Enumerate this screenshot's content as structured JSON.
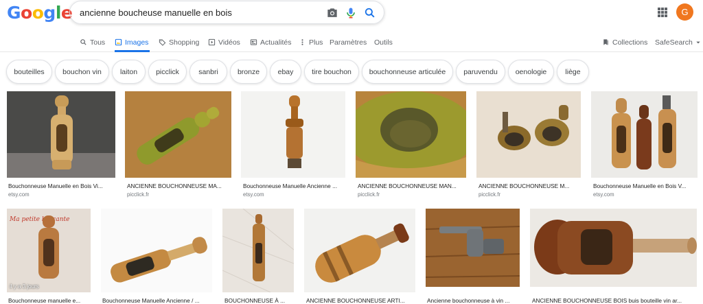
{
  "search": {
    "query": "ancienne boucheuse manuelle en bois"
  },
  "header": {
    "avatar_letter": "G",
    "avatar_color": "#f0771f"
  },
  "tabs": [
    {
      "label": "Tous",
      "icon": "search-icon"
    },
    {
      "label": "Images",
      "icon": "image-icon"
    },
    {
      "label": "Shopping",
      "icon": "tag-icon"
    },
    {
      "label": "Vidéos",
      "icon": "play-icon"
    },
    {
      "label": "Actualités",
      "icon": "news-icon"
    },
    {
      "label": "Plus",
      "icon": "more-vert-icon"
    },
    {
      "label": "Paramètres"
    },
    {
      "label": "Outils"
    }
  ],
  "right_tools": {
    "collections": "Collections",
    "safesearch": "SafeSearch"
  },
  "chips": [
    "bouteilles",
    "bouchon vin",
    "laiton",
    "picclick",
    "sanbri",
    "bronze",
    "ebay",
    "tire bouchon",
    "bouchonneuse articulée",
    "paruvendu",
    "oenologie",
    "liège"
  ],
  "row1": [
    {
      "title": "Bouchonneuse Manuelle en Bois Vi...",
      "source": "etsy.com"
    },
    {
      "title": "ANCIENNE BOUCHONNEUSE MA...",
      "source": "picclick.fr"
    },
    {
      "title": "Bouchonneuse Manuelle Ancienne ...",
      "source": "etsy.com"
    },
    {
      "title": "ANCIENNE BOUCHONNEUSE MAN...",
      "source": "picclick.fr"
    },
    {
      "title": "ANCIENNE BOUCHONNEUSE M...",
      "source": "picclick.fr"
    },
    {
      "title": "Bouchonneuse Manuelle en Bois V...",
      "source": "etsy.com"
    }
  ],
  "row2": [
    {
      "title": "Bouchonneuse manuelle e...",
      "overlay": "il y a 3 jours",
      "img_text": "Ma petite brocante"
    },
    {
      "title": "Bouchonneuse Manuelle Ancienne / ..."
    },
    {
      "title": "BOUCHONNEUSE À ..."
    },
    {
      "title": "ANCIENNE BOUCHONNEUSE ARTI..."
    },
    {
      "title": "Ancienne bouchonneuse à vin ..."
    },
    {
      "title": "ANCIENNE BOUCHONNEUSE BOIS buis bouteille vin ar..."
    }
  ],
  "colors": {
    "accent": "#1a73e8",
    "chip_border": "#dfe1e5"
  }
}
